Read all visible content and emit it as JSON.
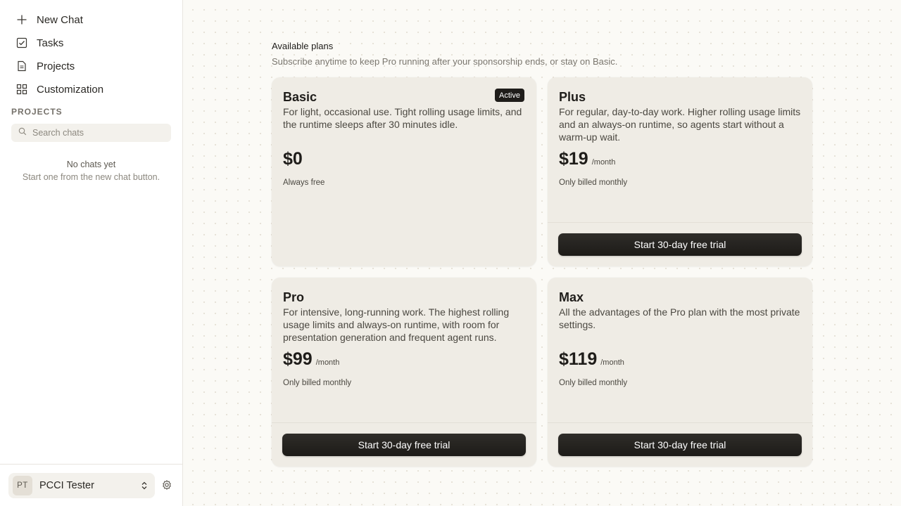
{
  "sidebar": {
    "nav": [
      {
        "label": "New Chat",
        "icon": "plus-icon"
      },
      {
        "label": "Tasks",
        "icon": "checkbox-icon"
      },
      {
        "label": "Projects",
        "icon": "document-icon"
      },
      {
        "label": "Customization",
        "icon": "grid-icon"
      }
    ],
    "section_label": "PROJECTS",
    "search_placeholder": "Search chats",
    "empty_title": "No chats yet",
    "empty_subtitle": "Start one from the new chat button.",
    "user": {
      "initials": "PT",
      "name": "PCCI Tester"
    }
  },
  "main": {
    "heading": "Available plans",
    "subheading": "Subscribe anytime to keep Pro running after your sponsorship ends, or stay on Basic.",
    "plans": [
      {
        "name": "Basic",
        "badge": "Active",
        "description": "For light, occasional use. Tight rolling usage limits, and the runtime sleeps after 30 minutes idle.",
        "price": "$0",
        "period": "",
        "billing": "Always free",
        "cta": ""
      },
      {
        "name": "Plus",
        "badge": "",
        "description": "For regular, day-to-day work. Higher rolling usage limits and an always-on runtime, so agents start without a warm-up wait.",
        "price": "$19",
        "period": "/month",
        "billing": "Only billed monthly",
        "cta": "Start 30-day free trial"
      },
      {
        "name": "Pro",
        "badge": "",
        "description": "For intensive, long-running work. The highest rolling usage limits and always-on runtime, with room for presentation generation and frequent agent runs.",
        "price": "$99",
        "period": "/month",
        "billing": "Only billed monthly",
        "cta": "Start 30-day free trial"
      },
      {
        "name": "Max",
        "badge": "",
        "description": "All the advantages of the Pro plan with the most private settings.",
        "price": "$119",
        "period": "/month",
        "billing": "Only billed monthly",
        "cta": "Start 30-day free trial"
      }
    ]
  },
  "colors": {
    "accent": "#1f1d1a",
    "card_bg": "#efece5",
    "page_bg": "#fbfaf6"
  }
}
